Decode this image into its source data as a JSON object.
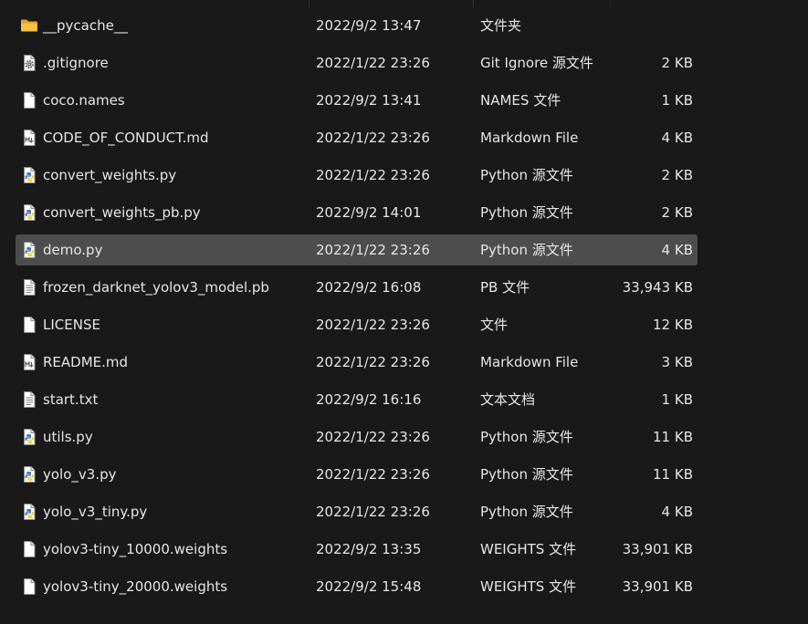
{
  "colors": {
    "background": "#191919",
    "selected_row": "#4d4d4d",
    "text": "#e6e6e6",
    "folder": "#f3c23e",
    "python_blue": "#3a76b0",
    "python_yellow": "#f5cf3c"
  },
  "files": [
    {
      "name": "__pycache__",
      "date": "2022/9/2 13:47",
      "type": "文件夹",
      "size": "",
      "icon": "folder-icon",
      "selected": false
    },
    {
      "name": ".gitignore",
      "date": "2022/1/22 23:26",
      "type": "Git Ignore 源文件",
      "size": "2 KB",
      "icon": "settings-file-icon",
      "selected": false
    },
    {
      "name": "coco.names",
      "date": "2022/9/2 13:41",
      "type": "NAMES 文件",
      "size": "1 KB",
      "icon": "file-icon",
      "selected": false
    },
    {
      "name": "CODE_OF_CONDUCT.md",
      "date": "2022/1/22 23:26",
      "type": "Markdown File",
      "size": "4 KB",
      "icon": "markdown-file-icon",
      "selected": false
    },
    {
      "name": "convert_weights.py",
      "date": "2022/1/22 23:26",
      "type": "Python 源文件",
      "size": "2 KB",
      "icon": "python-file-icon",
      "selected": false
    },
    {
      "name": "convert_weights_pb.py",
      "date": "2022/9/2 14:01",
      "type": "Python 源文件",
      "size": "2 KB",
      "icon": "python-file-icon",
      "selected": false
    },
    {
      "name": "demo.py",
      "date": "2022/1/22 23:26",
      "type": "Python 源文件",
      "size": "4 KB",
      "icon": "python-file-icon",
      "selected": true
    },
    {
      "name": "frozen_darknet_yolov3_model.pb",
      "date": "2022/9/2 16:08",
      "type": "PB 文件",
      "size": "33,943 KB",
      "icon": "text-file-icon",
      "selected": false
    },
    {
      "name": "LICENSE",
      "date": "2022/1/22 23:26",
      "type": "文件",
      "size": "12 KB",
      "icon": "file-icon",
      "selected": false
    },
    {
      "name": "README.md",
      "date": "2022/1/22 23:26",
      "type": "Markdown File",
      "size": "3 KB",
      "icon": "markdown-file-icon",
      "selected": false
    },
    {
      "name": "start.txt",
      "date": "2022/9/2 16:16",
      "type": "文本文档",
      "size": "1 KB",
      "icon": "text-file-icon",
      "selected": false
    },
    {
      "name": "utils.py",
      "date": "2022/1/22 23:26",
      "type": "Python 源文件",
      "size": "11 KB",
      "icon": "python-file-icon",
      "selected": false
    },
    {
      "name": "yolo_v3.py",
      "date": "2022/1/22 23:26",
      "type": "Python 源文件",
      "size": "11 KB",
      "icon": "python-file-icon",
      "selected": false
    },
    {
      "name": "yolo_v3_tiny.py",
      "date": "2022/1/22 23:26",
      "type": "Python 源文件",
      "size": "4 KB",
      "icon": "python-file-icon",
      "selected": false
    },
    {
      "name": "yolov3-tiny_10000.weights",
      "date": "2022/9/2 13:35",
      "type": "WEIGHTS 文件",
      "size": "33,901 KB",
      "icon": "file-icon",
      "selected": false
    },
    {
      "name": "yolov3-tiny_20000.weights",
      "date": "2022/9/2 15:48",
      "type": "WEIGHTS 文件",
      "size": "33,901 KB",
      "icon": "file-icon",
      "selected": false
    }
  ]
}
